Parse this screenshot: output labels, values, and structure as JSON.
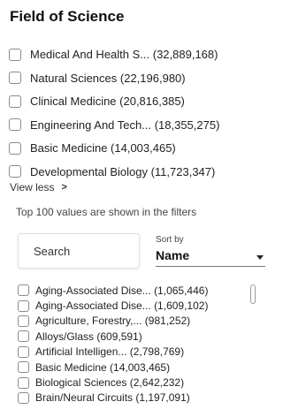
{
  "panel": {
    "title": "Field of Science",
    "top_items": [
      {
        "label": "Medical And Health S... (32,889,168)"
      },
      {
        "label": "Natural Sciences (22,196,980)"
      },
      {
        "label": "Clinical Medicine (20,816,385)"
      },
      {
        "label": "Engineering And Tech... (18,355,275)"
      },
      {
        "label": "Basic Medicine (14,003,465)"
      },
      {
        "label": "Developmental Biology (11,723,347)"
      }
    ],
    "view_less": "View less",
    "view_less_chevron": ">",
    "note": "Top 100 values are shown in the filters",
    "search": {
      "placeholder": "Search",
      "value": ""
    },
    "sort": {
      "label": "Sort by",
      "value": "Name"
    },
    "list_items": [
      {
        "label": "Aging-Associated Dise... (1,065,446)"
      },
      {
        "label": "Aging-Associated Dise... (1,609,102)"
      },
      {
        "label": "Agriculture, Forestry,... (981,252)"
      },
      {
        "label": "Alloys/Glass (609,591)"
      },
      {
        "label": "Artificial Intelligen... (2,798,769)"
      },
      {
        "label": "Basic Medicine (14,003,465)"
      },
      {
        "label": "Biological Sciences (2,642,232)"
      },
      {
        "label": "Brain/Neural Circuits (1,197,091)"
      }
    ]
  }
}
